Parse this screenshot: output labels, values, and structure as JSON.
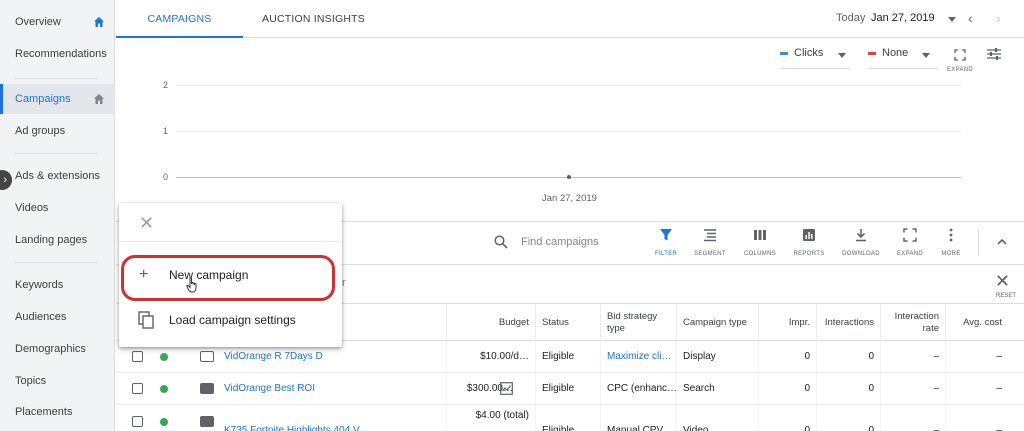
{
  "sidebar": {
    "items": [
      {
        "label": "Overview",
        "home": true
      },
      {
        "label": "Recommendations"
      },
      {
        "label": "Campaigns",
        "home": true,
        "active": true
      },
      {
        "label": "Ad groups"
      },
      {
        "label": "Ads & extensions"
      },
      {
        "label": "Videos"
      },
      {
        "label": "Landing pages"
      },
      {
        "label": "Keywords"
      },
      {
        "label": "Audiences"
      },
      {
        "label": "Demographics"
      },
      {
        "label": "Topics"
      },
      {
        "label": "Placements"
      }
    ]
  },
  "tabs": [
    {
      "label": "CAMPAIGNS",
      "active": true
    },
    {
      "label": "AUCTION INSIGHTS"
    }
  ],
  "date": {
    "label": "Today",
    "value": "Jan 27, 2019"
  },
  "chart_controls": {
    "metric1": "Clicks",
    "metric1_color": "#4285f4",
    "metric2": "None",
    "metric2_color": "#db4437",
    "expand": "EXPAND"
  },
  "chart_data": {
    "type": "line",
    "y_ticks": [
      "2",
      "1",
      "0"
    ],
    "x_ticks": [
      "Jan 27, 2019"
    ],
    "x": [
      "Jan 27, 2019"
    ],
    "series": [
      {
        "name": "Clicks",
        "values": [
          0
        ]
      }
    ],
    "ylim": [
      0,
      2
    ]
  },
  "toolbar": {
    "search_placeholder": "Find campaigns",
    "filter": "FILTER",
    "segment": "SEGMENT",
    "columns": "COLUMNS",
    "reports": "REPORTS",
    "download": "DOWNLOAD",
    "expand": "EXPAND",
    "more": "MORE"
  },
  "filterrow": {
    "reset": "RESET",
    "stub": "r"
  },
  "popup": {
    "new_campaign": "New campaign",
    "load_settings": "Load campaign settings"
  },
  "table": {
    "headers": {
      "budget": "Budget",
      "status": "Status",
      "bid_strategy": "Bid strategy type",
      "campaign_type": "Campaign type",
      "impr": "Impr.",
      "interactions": "Interactions",
      "interaction_rate": "Interaction rate",
      "avg_cost": "Avg. cost"
    },
    "rows": [
      {
        "campaign": "VidOrange R 7Days D",
        "budget": "$10.00/d…",
        "status": "Eligible",
        "bid_strategy": "Maximize cli…",
        "type": "Display",
        "impr": "0",
        "interactions": "0",
        "interaction_rate": "–",
        "avg_cost": "–"
      },
      {
        "campaign": "VidOrange Best ROI",
        "budget": "$300.00…",
        "status": "Eligible",
        "bid_strategy": "CPC (enhanc…",
        "type": "Search",
        "impr": "0",
        "interactions": "0",
        "interaction_rate": "–",
        "avg_cost": "–"
      },
      {
        "campaign": "K735 Fortnite Highlights 404 V",
        "budget": "$4.00 (total)",
        "status": "Eligible",
        "bid_strategy": "Manual CPV",
        "type": "Video",
        "impr": "0",
        "interactions": "0",
        "interaction_rate": "–",
        "avg_cost": "–"
      }
    ]
  }
}
